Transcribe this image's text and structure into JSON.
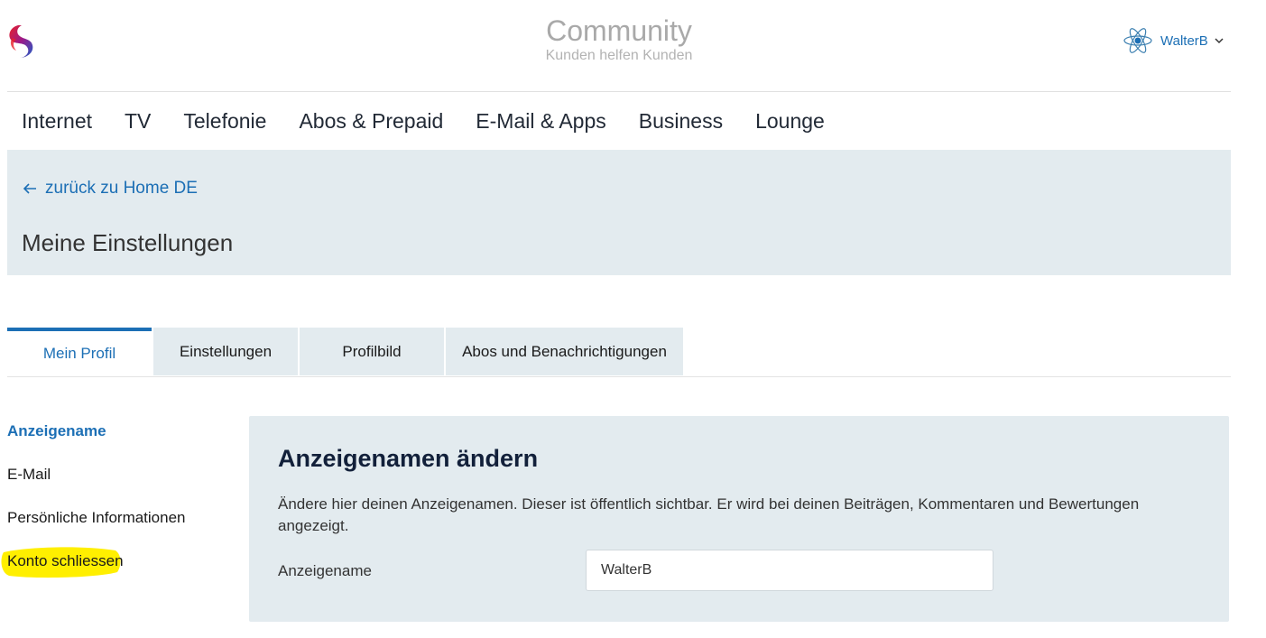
{
  "header": {
    "title": "Community",
    "subtitle": "Kunden helfen Kunden",
    "user": {
      "name": "WalterB",
      "avatar_icon": "atom-avatar-icon",
      "menu_icon": "chevron-down-icon"
    },
    "logo_icon": "swisscom-logo-icon"
  },
  "nav": {
    "items": [
      {
        "label": "Internet"
      },
      {
        "label": "TV"
      },
      {
        "label": "Telefonie"
      },
      {
        "label": "Abos & Prepaid"
      },
      {
        "label": "E-Mail & Apps"
      },
      {
        "label": "Business"
      },
      {
        "label": "Lounge"
      }
    ]
  },
  "banner": {
    "back_label": "zurück zu Home DE",
    "back_icon": "arrow-left-icon",
    "title": "Meine Einstellungen"
  },
  "tabs": [
    {
      "label": "Mein Profil",
      "active": true
    },
    {
      "label": "Einstellungen"
    },
    {
      "label": "Profilbild"
    },
    {
      "label": "Abos und Benachrichtigungen"
    }
  ],
  "sidebar": {
    "items": [
      {
        "label": "Anzeigename",
        "active": true
      },
      {
        "label": "E-Mail"
      },
      {
        "label": "Persönliche Informationen"
      },
      {
        "label": "Konto schliessen",
        "highlighted": true
      }
    ]
  },
  "panel": {
    "title": "Anzeigenamen ändern",
    "description": "Ändere hier deinen Anzeigenamen. Dieser ist öffentlich sichtbar. Er wird bei deinen Beiträgen, Kommentaren und Bewertungen angezeigt.",
    "field_label": "Anzeigename",
    "field_value": "WalterB"
  },
  "colors": {
    "accent": "#1c6fb5",
    "banner_bg": "#e3ebef",
    "highlight": "#ffef00"
  }
}
